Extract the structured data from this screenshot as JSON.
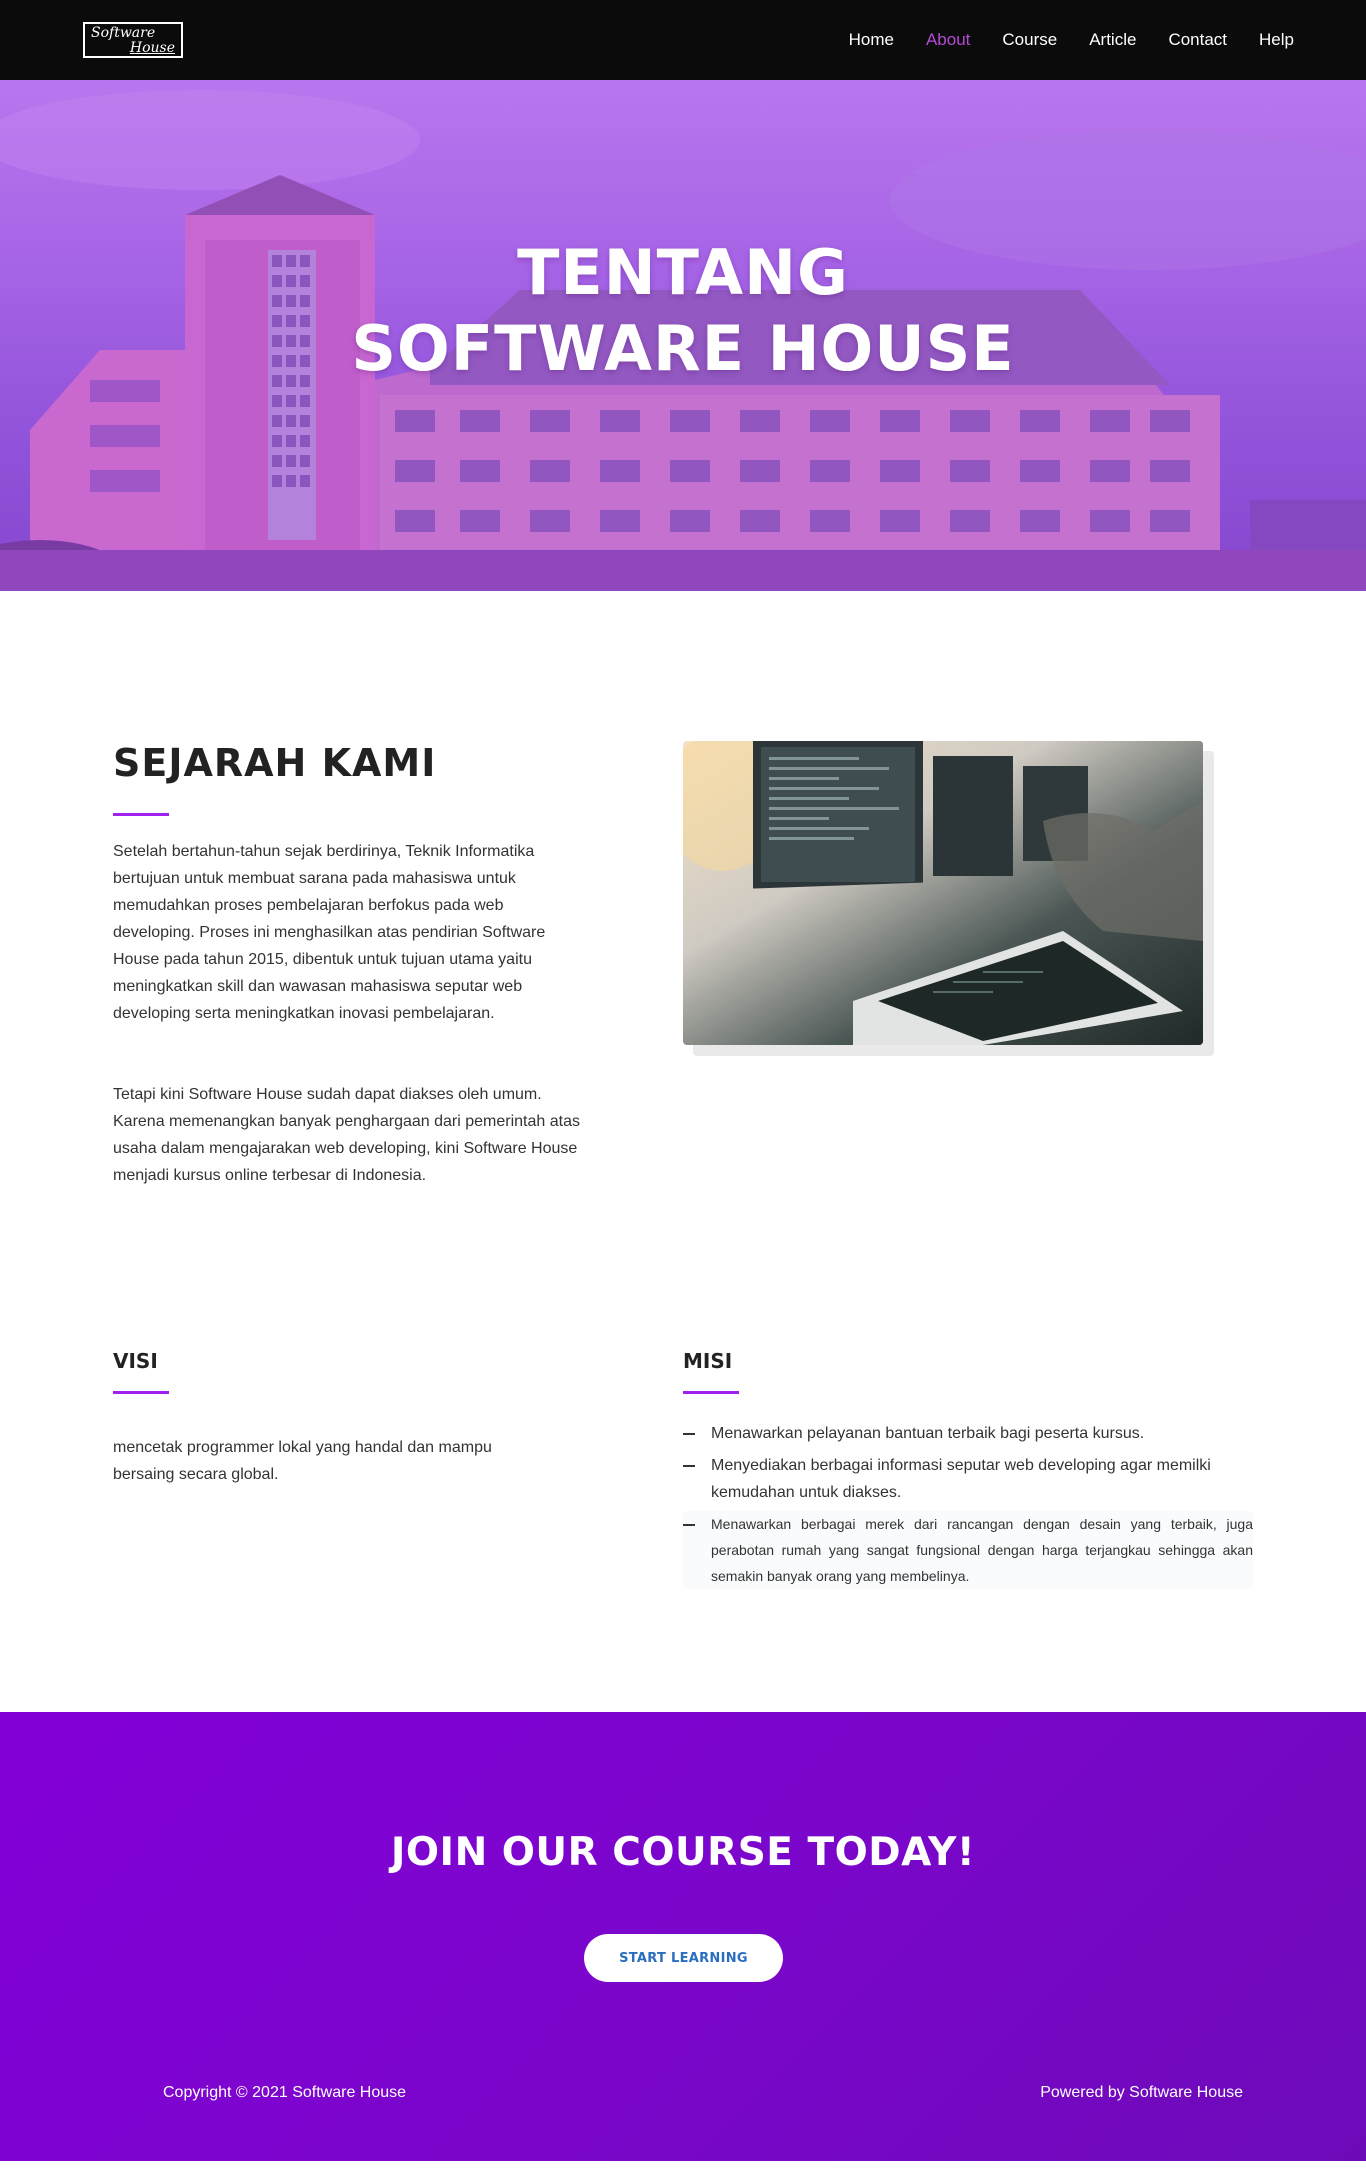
{
  "nav": {
    "logo_line1": "Software",
    "logo_line2": "House",
    "links": [
      "Home",
      "About",
      "Course",
      "Article",
      "Contact",
      "Help"
    ],
    "active": "About"
  },
  "hero": {
    "title_line1": "TENTANG",
    "title_line2": "SOFTWARE HOUSE"
  },
  "history": {
    "title": "SEJARAH KAMI",
    "paragraph1": "Setelah bertahun-tahun sejak berdirinya, Teknik Informatika bertujuan untuk membuat sarana pada mahasiswa untuk memudahkan proses pembelajaran berfokus pada web developing. Proses ini menghasilkan atas pendirian Software House pada tahun 2015, dibentuk untuk tujuan utama yaitu meningkatkan skill dan wawasan mahasiswa seputar web developing serta meningkatkan inovasi pembelajaran.",
    "paragraph2": "Tetapi kini Software House sudah dapat diakses oleh umum. Karena memenangkan banyak penghargaan dari pemerintah atas usaha dalam mengajarakan web developing, kini Software House menjadi kursus online terbesar di Indonesia."
  },
  "visi": {
    "title": "VISI",
    "text": "mencetak programmer lokal yang handal dan mampu bersaing secara global."
  },
  "misi": {
    "title": "MISI",
    "items": [
      "Menawarkan pelayanan bantuan terbaik bagi peserta kursus.",
      "Menyediakan berbagai informasi seputar web developing agar memilki kemudahan untuk diakses.",
      "Menawarkan berbagai merek dari rancangan dengan desain yang terbaik, juga perabotan rumah yang sangat fungsional dengan harga terjangkau sehingga akan semakin banyak orang yang membelinya."
    ]
  },
  "cta": {
    "title": "JOIN OUR COURSE TODAY!",
    "button": "START LEARNING"
  },
  "footer": {
    "copyright": "Copyright © 2021 Software House",
    "powered": "Powered by Software House"
  },
  "colors": {
    "accent": "#a020f0",
    "nav_active": "#b44ad6",
    "cta_bg": "#7b06cc",
    "button_text": "#2a6ec0"
  }
}
